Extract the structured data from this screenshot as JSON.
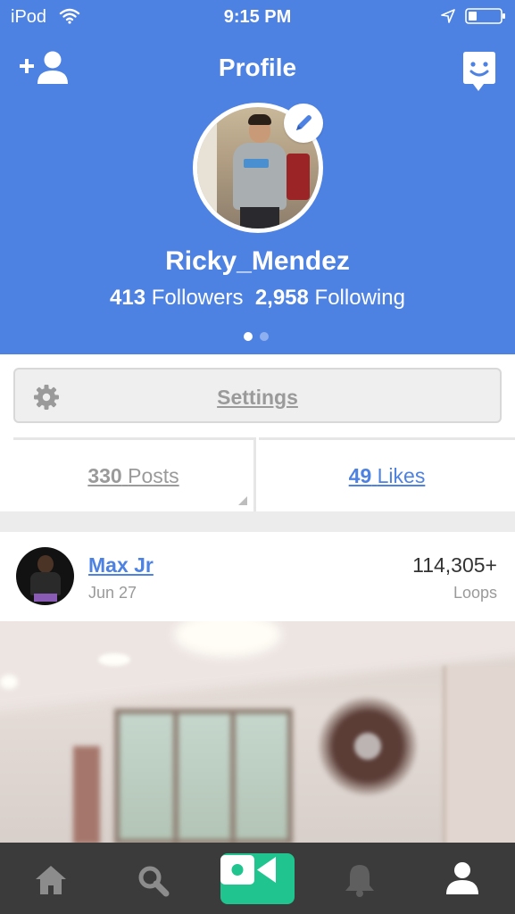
{
  "status_bar": {
    "carrier": "iPod",
    "time": "9:15 PM",
    "wifi_icon": "wifi-icon",
    "location_icon": "location-arrow-icon",
    "battery_icon": "battery-icon"
  },
  "header": {
    "title": "Profile",
    "add_friend_icon": "add-friend-icon",
    "chat_icon": "chat-icon",
    "accent_color": "#4d82e3"
  },
  "profile": {
    "username": "Ricky_Mendez",
    "followers_count": "413",
    "followers_label": "Followers",
    "following_count": "2,958",
    "following_label": "Following",
    "edit_icon": "pencil-icon",
    "page_indicator": {
      "pages": 2,
      "active": 1
    }
  },
  "settings": {
    "label": "Settings",
    "icon": "gear-icon"
  },
  "stats": {
    "posts_count": "330",
    "posts_label": "Posts",
    "likes_count": "49",
    "likes_label": "Likes",
    "selected_tab": "Likes"
  },
  "feed": {
    "items": [
      {
        "author": "Max Jr",
        "date": "Jun 27",
        "loops_count": "114,305+",
        "loops_label": "Loops"
      }
    ]
  },
  "tab_bar": {
    "items": [
      {
        "name": "home",
        "icon": "home-icon"
      },
      {
        "name": "search",
        "icon": "search-icon"
      },
      {
        "name": "record",
        "icon": "video-camera-icon",
        "color": "#20c48f"
      },
      {
        "name": "activity",
        "icon": "bell-icon"
      },
      {
        "name": "profile",
        "icon": "user-icon",
        "active": true
      }
    ]
  }
}
